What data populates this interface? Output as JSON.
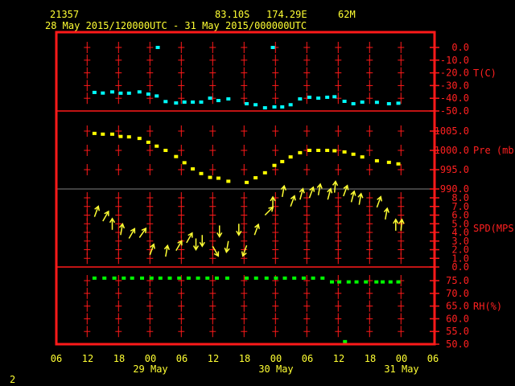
{
  "header": {
    "station": "21357",
    "lat": "83.10S",
    "lon": "174.29E",
    "elev": "62M",
    "period": "28 May 2015/120000UTC - 31 May 2015/000000UTC"
  },
  "footer": {
    "page": "2"
  },
  "colors": {
    "frame": "#ff1a1a",
    "temp": "#00ffff",
    "pres": "#ffff00",
    "wind": "#ffff33",
    "rh": "#00ff00",
    "divider_gray": "#808080"
  },
  "chart_data": {
    "type": "scatter",
    "x_units": "hours since 28 May 2015 12 UTC",
    "xlim": [
      -6,
      66
    ],
    "x_tick_labels": [
      "06",
      "12",
      "18",
      "00",
      "06",
      "12",
      "18",
      "00",
      "06",
      "12",
      "18",
      "00",
      "06"
    ],
    "date_labels": [
      {
        "text": "29 May",
        "at_tick": 3
      },
      {
        "text": "30 May",
        "at_tick": 7
      },
      {
        "text": "31 May",
        "at_tick": 11
      }
    ],
    "panels": [
      {
        "name": "temperature",
        "ylabel": "T(C)",
        "ylim": [
          -50,
          0
        ],
        "tick_labels": [
          "0.0",
          "-10.0",
          "-20.0",
          "-30.0",
          "-40.0",
          "-50.0"
        ],
        "tick_values": [
          0,
          -10,
          -20,
          -30,
          -40,
          -50
        ],
        "points": [
          [
            1.4,
            -35.4
          ],
          [
            3,
            -35.9
          ],
          [
            4.8,
            -35
          ],
          [
            6.4,
            -36
          ],
          [
            8,
            -36
          ],
          [
            10,
            -35
          ],
          [
            11.7,
            -36.7
          ],
          [
            13.3,
            -38.2
          ],
          [
            13.5,
            0
          ],
          [
            15,
            -42.6
          ],
          [
            17,
            -43.7
          ],
          [
            18.6,
            -43
          ],
          [
            20.2,
            -43
          ],
          [
            21.8,
            -43
          ],
          [
            23.5,
            -39.9
          ],
          [
            25.1,
            -41.8
          ],
          [
            27,
            -40.5
          ],
          [
            30.5,
            -44.3
          ],
          [
            32.2,
            -45.1
          ],
          [
            34,
            -47.5
          ],
          [
            35.5,
            0
          ],
          [
            35.8,
            -46.8
          ],
          [
            37.3,
            -46.8
          ],
          [
            38.9,
            -45.1
          ],
          [
            40.7,
            -40.5
          ],
          [
            42.5,
            -39.2
          ],
          [
            44.2,
            -39.9
          ],
          [
            45.9,
            -39.2
          ],
          [
            47.3,
            -38.8
          ],
          [
            49.2,
            -42.4
          ],
          [
            50.9,
            -44.3
          ],
          [
            52.6,
            -43
          ],
          [
            55.4,
            -43.2
          ],
          [
            57.7,
            -44.3
          ],
          [
            59.5,
            -43.9
          ]
        ]
      },
      {
        "name": "pressure",
        "ylabel": "Pre (mb)",
        "ylim": [
          990,
          1010
        ],
        "tick_labels": [
          "1005.0",
          "1000.0",
          "995.0",
          "990.0"
        ],
        "tick_values": [
          1005,
          1000,
          995,
          990
        ],
        "points": [
          [
            1.4,
            1004.4
          ],
          [
            3,
            1004.2
          ],
          [
            4.8,
            1004.2
          ],
          [
            6.4,
            1003.6
          ],
          [
            8,
            1003.5
          ],
          [
            10,
            1003.1
          ],
          [
            11.7,
            1002.1
          ],
          [
            13.3,
            1001.1
          ],
          [
            15,
            1000.0
          ],
          [
            17,
            998.4
          ],
          [
            18.6,
            996.8
          ],
          [
            20.2,
            995.2
          ],
          [
            21.8,
            994.0
          ],
          [
            23.5,
            993.0
          ],
          [
            25.1,
            992.8
          ],
          [
            27,
            992.0
          ],
          [
            30.5,
            991.7
          ],
          [
            32.2,
            992.9
          ],
          [
            34,
            994.2
          ],
          [
            35.8,
            996.1
          ],
          [
            37.3,
            997.1
          ],
          [
            38.9,
            998.3
          ],
          [
            40.7,
            999.4
          ],
          [
            42.5,
            1000.0
          ],
          [
            44.2,
            1000.0
          ],
          [
            45.9,
            1000.0
          ],
          [
            47.3,
            999.9
          ],
          [
            49.2,
            999.6
          ],
          [
            50.9,
            999.0
          ],
          [
            52.6,
            998.3
          ],
          [
            55.4,
            997.3
          ],
          [
            57.7,
            996.9
          ],
          [
            59.5,
            996.5
          ]
        ]
      },
      {
        "name": "wind_speed",
        "ylabel": "SPD(MPS)",
        "ylim": [
          0,
          9
        ],
        "tick_labels": [
          "8.0",
          "7.0",
          "6.0",
          "5.0",
          "4.0",
          "3.0",
          "2.0",
          "1.0",
          "0.0"
        ],
        "tick_values": [
          8,
          7,
          6,
          5,
          4,
          3,
          2,
          1,
          0
        ],
        "points": [
          [
            1.4,
            5.8,
            200
          ],
          [
            3,
            5.3,
            210
          ],
          [
            4.8,
            4.3,
            180
          ],
          [
            6.4,
            3.7,
            190
          ],
          [
            8,
            3.3,
            210
          ],
          [
            10,
            3.4,
            215
          ],
          [
            12,
            1.4,
            200
          ],
          [
            15,
            1.2,
            190
          ],
          [
            17,
            1.9,
            210
          ],
          [
            19,
            2.8,
            210
          ],
          [
            20.8,
            3.3,
            0
          ],
          [
            22,
            3.7,
            0
          ],
          [
            24,
            2.4,
            330
          ],
          [
            25.3,
            4.8,
            0
          ],
          [
            27,
            3,
            10
          ],
          [
            29,
            5,
            0
          ],
          [
            30.5,
            2.5,
            20
          ],
          [
            32,
            3.7,
            200
          ],
          [
            34,
            6,
            225
          ],
          [
            35.5,
            6.8,
            180
          ],
          [
            37.3,
            8.1,
            190
          ],
          [
            38.9,
            7,
            200
          ],
          [
            40.7,
            7.8,
            195
          ],
          [
            42.5,
            8,
            200
          ],
          [
            44.2,
            8.3,
            190
          ],
          [
            46,
            7.8,
            195
          ],
          [
            47.3,
            8.6,
            185
          ],
          [
            49,
            8.2,
            200
          ],
          [
            50.5,
            7.5,
            195
          ],
          [
            52,
            7.2,
            190
          ],
          [
            55.4,
            6.9,
            200
          ],
          [
            57,
            5.5,
            190
          ],
          [
            59,
            4.2,
            180
          ],
          [
            60,
            4.2,
            185
          ]
        ]
      },
      {
        "name": "relative_humidity",
        "ylabel": "RH(%)",
        "ylim": [
          50,
          80
        ],
        "tick_labels": [
          "75.0",
          "70.0",
          "65.0",
          "60.0",
          "55.0",
          "50.0"
        ],
        "tick_values": [
          75,
          70,
          65,
          60,
          55,
          50
        ],
        "points": [
          [
            1.4,
            76
          ],
          [
            3.3,
            76
          ],
          [
            5.2,
            76
          ],
          [
            7,
            76
          ],
          [
            8.6,
            76
          ],
          [
            10.5,
            76
          ],
          [
            12.3,
            76
          ],
          [
            14,
            76
          ],
          [
            15.8,
            76
          ],
          [
            17.6,
            76
          ],
          [
            19.4,
            76
          ],
          [
            21.2,
            76
          ],
          [
            23,
            76
          ],
          [
            24.8,
            76
          ],
          [
            26.8,
            76
          ],
          [
            30.5,
            76
          ],
          [
            32.3,
            76
          ],
          [
            34.3,
            76
          ],
          [
            36.1,
            76
          ],
          [
            37.8,
            76
          ],
          [
            39.6,
            76
          ],
          [
            41.4,
            76
          ],
          [
            43.2,
            76
          ],
          [
            45,
            76
          ],
          [
            46.8,
            74.5
          ],
          [
            48.2,
            74.5
          ],
          [
            49.3,
            51
          ],
          [
            50,
            74.5
          ],
          [
            51.5,
            74.5
          ],
          [
            53.3,
            74.5
          ],
          [
            55.3,
            74.5
          ],
          [
            56.5,
            74.5
          ],
          [
            58,
            74.5
          ],
          [
            59.5,
            74.5
          ]
        ]
      }
    ]
  }
}
